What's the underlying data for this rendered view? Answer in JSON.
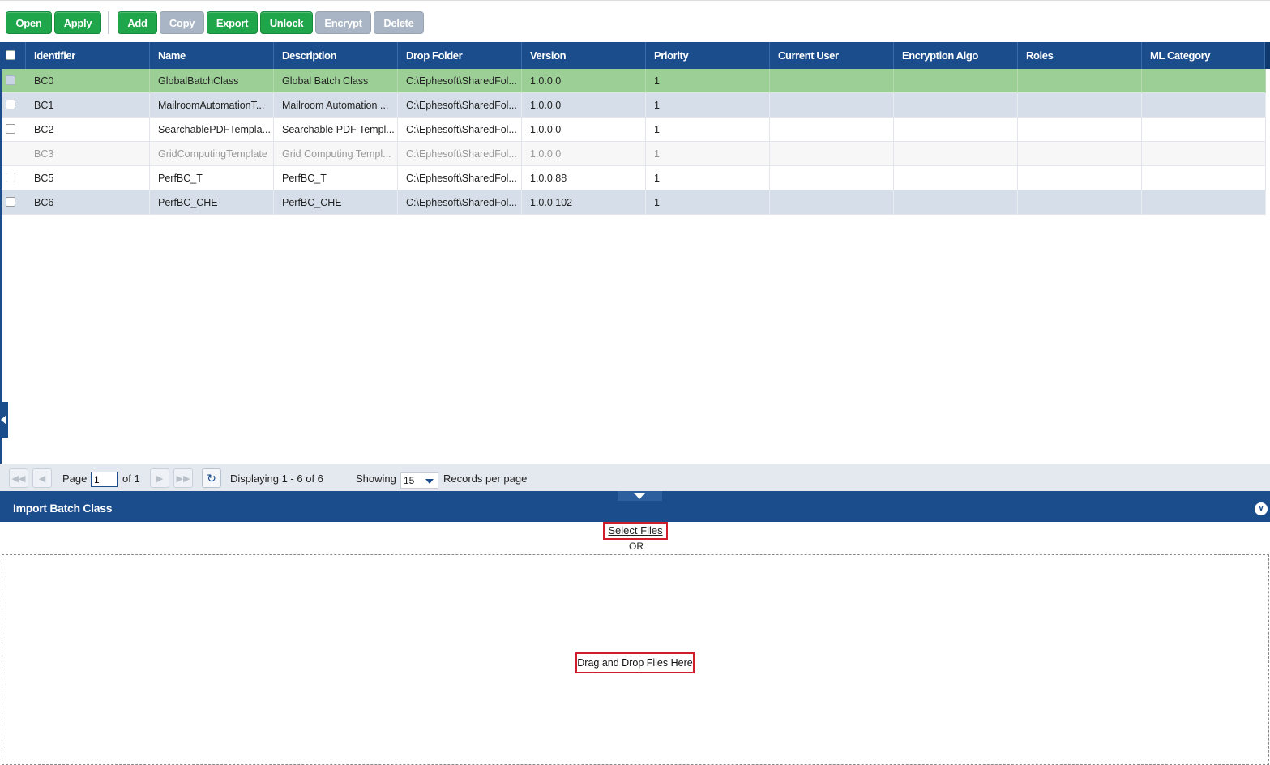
{
  "toolbar": {
    "buttons": [
      {
        "label": "Open",
        "state": "enabled"
      },
      {
        "label": "Apply",
        "state": "enabled"
      },
      {
        "label": "Add",
        "state": "enabled"
      },
      {
        "label": "Copy",
        "state": "disabled"
      },
      {
        "label": "Export",
        "state": "enabled"
      },
      {
        "label": "Unlock",
        "state": "enabled"
      },
      {
        "label": "Encrypt",
        "state": "disabled"
      },
      {
        "label": "Delete",
        "state": "disabled"
      }
    ]
  },
  "grid": {
    "columns": [
      "Identifier",
      "Name",
      "Description",
      "Drop Folder",
      "Version",
      "Priority",
      "Current User",
      "Encryption Algo",
      "Roles",
      "ML Category"
    ],
    "rows": [
      {
        "identifier": "BC0",
        "name": "GlobalBatchClass",
        "description": "Global Batch Class",
        "drop_folder": "C:\\Ephesoft\\SharedFol...",
        "version": "1.0.0.0",
        "priority": "1",
        "current_user": "",
        "encryption_algo": "",
        "roles": "",
        "ml_category": ""
      },
      {
        "identifier": "BC1",
        "name": "MailroomAutomationT...",
        "description": "Mailroom Automation ...",
        "drop_folder": "C:\\Ephesoft\\SharedFol...",
        "version": "1.0.0.0",
        "priority": "1",
        "current_user": "",
        "encryption_algo": "",
        "roles": "",
        "ml_category": ""
      },
      {
        "identifier": "BC2",
        "name": "SearchablePDFTempla...",
        "description": "Searchable PDF Templ...",
        "drop_folder": "C:\\Ephesoft\\SharedFol...",
        "version": "1.0.0.0",
        "priority": "1",
        "current_user": "",
        "encryption_algo": "",
        "roles": "",
        "ml_category": ""
      },
      {
        "identifier": "BC3",
        "name": "GridComputingTemplate",
        "description": "Grid Computing Templ...",
        "drop_folder": "C:\\Ephesoft\\SharedFol...",
        "version": "1.0.0.0",
        "priority": "1",
        "current_user": "",
        "encryption_algo": "",
        "roles": "",
        "ml_category": ""
      },
      {
        "identifier": "BC5",
        "name": "PerfBC_T",
        "description": "PerfBC_T",
        "drop_folder": "C:\\Ephesoft\\SharedFol...",
        "version": "1.0.0.88",
        "priority": "1",
        "current_user": "",
        "encryption_algo": "",
        "roles": "",
        "ml_category": ""
      },
      {
        "identifier": "BC6",
        "name": "PerfBC_CHE",
        "description": "PerfBC_CHE",
        "drop_folder": "C:\\Ephesoft\\SharedFol...",
        "version": "1.0.0.102",
        "priority": "1",
        "current_user": "",
        "encryption_algo": "",
        "roles": "",
        "ml_category": ""
      }
    ],
    "row_states": [
      "selected",
      "alternate",
      "plain",
      "disabled",
      "plain",
      "alternate"
    ],
    "colors": {
      "header": "#1b4c8c",
      "selected_row": "#9ccf96",
      "alternate_row": "#d6dfe9"
    }
  },
  "pager": {
    "page_label": "Page",
    "page_value": "1",
    "of_label": "of 1",
    "displaying": "Displaying 1 - 6 of 6",
    "showing_label": "Showing",
    "per_page_value": "15",
    "records_label": "Records per page"
  },
  "import_panel": {
    "title": "Import Batch Class",
    "select_files": "Select Files",
    "or": "OR",
    "drop_label": "Drag and Drop Files Here"
  },
  "icons": [
    "first-page-icon",
    "prev-page-icon",
    "next-page-icon",
    "last-page-icon",
    "refresh-icon",
    "dropdown-arrow-icon",
    "collapse-panel-icon",
    "splitter-down-icon",
    "sidebar-collapse-icon"
  ]
}
